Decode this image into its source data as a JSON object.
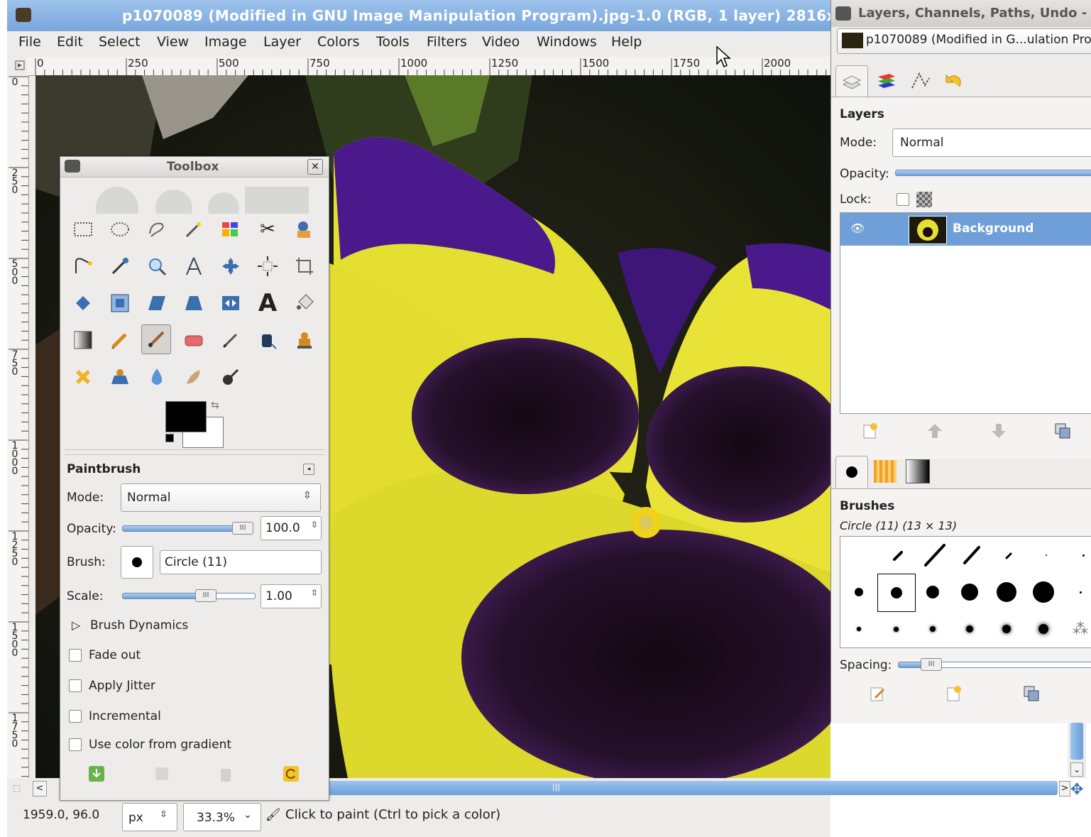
{
  "window": {
    "title": "p1070089 (Modified in GNU Image Manipulation Program).jpg-1.0 (RGB, 1 layer) 2816x"
  },
  "menubar": [
    "File",
    "Edit",
    "Select",
    "View",
    "Image",
    "Layer",
    "Colors",
    "Tools",
    "Filters",
    "Video",
    "Windows",
    "Help"
  ],
  "hruler": {
    "labels": [
      "0",
      "250",
      "500",
      "750",
      "1000",
      "1250",
      "1500",
      "1750",
      "2000"
    ]
  },
  "vruler": {
    "labels": [
      "0",
      "250",
      "500",
      "750",
      "1000",
      "1250",
      "1500",
      "1750"
    ]
  },
  "toolbox": {
    "title": "Toolbox",
    "tools": [
      [
        "rect-select",
        "ellipse-select",
        "free-select",
        "fuzzy-select",
        "color-select",
        "scissors-select",
        "foreground-select"
      ],
      [
        "paths",
        "color-picker",
        "zoom",
        "measure",
        "move",
        "align",
        "crop"
      ],
      [
        "rotate",
        "scale",
        "shear",
        "perspective",
        "flip",
        "text",
        "bucket-fill"
      ],
      [
        "blend",
        "pencil",
        "paintbrush",
        "eraser",
        "airbrush",
        "ink",
        "clone"
      ],
      [
        "heal",
        "perspective-clone",
        "blur-sharpen",
        "smudge",
        "dodge-burn"
      ]
    ],
    "active_tool": "paintbrush",
    "fg_color": "#000000",
    "bg_color": "#ffffff"
  },
  "tool_options": {
    "title": "Paintbrush",
    "mode_label": "Mode:",
    "mode_value": "Normal",
    "opacity_label": "Opacity:",
    "opacity_value": "100.0",
    "brush_label": "Brush:",
    "brush_value": "Circle (11)",
    "scale_label": "Scale:",
    "scale_value": "1.00",
    "dynamics_label": "Brush Dynamics",
    "checkboxes": [
      {
        "label": "Fade out",
        "checked": false
      },
      {
        "label": "Apply Jitter",
        "checked": false
      },
      {
        "label": "Incremental",
        "checked": false
      },
      {
        "label": "Use color from gradient",
        "checked": false
      }
    ]
  },
  "statusbar": {
    "coords": "1959.0, 96.0",
    "unit": "px",
    "zoom": "33.3%",
    "message": "Click to paint (Ctrl to pick a color)"
  },
  "dock": {
    "title": "Layers, Channels, Paths, Undo - B",
    "image_name": "p1070089 (Modified in G...ulation Pro",
    "layers_title": "Layers",
    "mode_label": "Mode:",
    "mode_value": "Normal",
    "opacity_label": "Opacity:",
    "lock_label": "Lock:",
    "layer_name": "Background",
    "brushes_title": "Brushes",
    "brush_info": "Circle (11) (13 × 13)",
    "spacing_label": "Spacing:"
  },
  "colors": {
    "title_bar": "#8fb7e6",
    "selection": "#6e9fd8",
    "petal_yellow": "#e6e234",
    "petal_purple": "#4a1a8c",
    "blotch": "#1a0a14"
  }
}
